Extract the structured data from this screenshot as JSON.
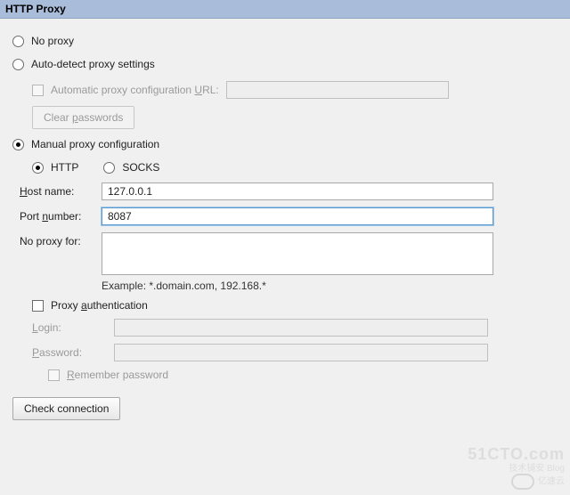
{
  "title": "HTTP Proxy",
  "options": {
    "no_proxy": "No proxy",
    "auto_detect": "Auto-detect proxy settings",
    "auto_config_url_label_pre": "Automatic proxy configuration ",
    "auto_config_url_u": "U",
    "auto_config_url_label_post": "RL:",
    "auto_config_url_value": "",
    "clear_pwd_pre": "Clear ",
    "clear_pwd_u": "p",
    "clear_pwd_post": "asswords",
    "manual": "Manual proxy configuration",
    "http": "HTTP",
    "socks": "SOCKS"
  },
  "form": {
    "host_u": "H",
    "host_label": "ost name:",
    "host_value": "127.0.0.1",
    "port_pre": "Port ",
    "port_u": "n",
    "port_post": "umber:",
    "port_value": "8087",
    "noproxy_label": "No proxy for:",
    "noproxy_value": "",
    "example": "Example: *.domain.com, 192.168.*"
  },
  "auth": {
    "label_pre": "Proxy ",
    "label_u": "a",
    "label_post": "uthentication",
    "login_u": "L",
    "login_label": "ogin:",
    "login_value": "",
    "password_u": "P",
    "password_label": "assword:",
    "password_value": "",
    "remember_u": "R",
    "remember_label": "emember password"
  },
  "check_btn": "Check connection",
  "watermark": {
    "big": "51CTO.com",
    "small1": "技术铺安  Blog",
    "small2": "亿速云"
  }
}
